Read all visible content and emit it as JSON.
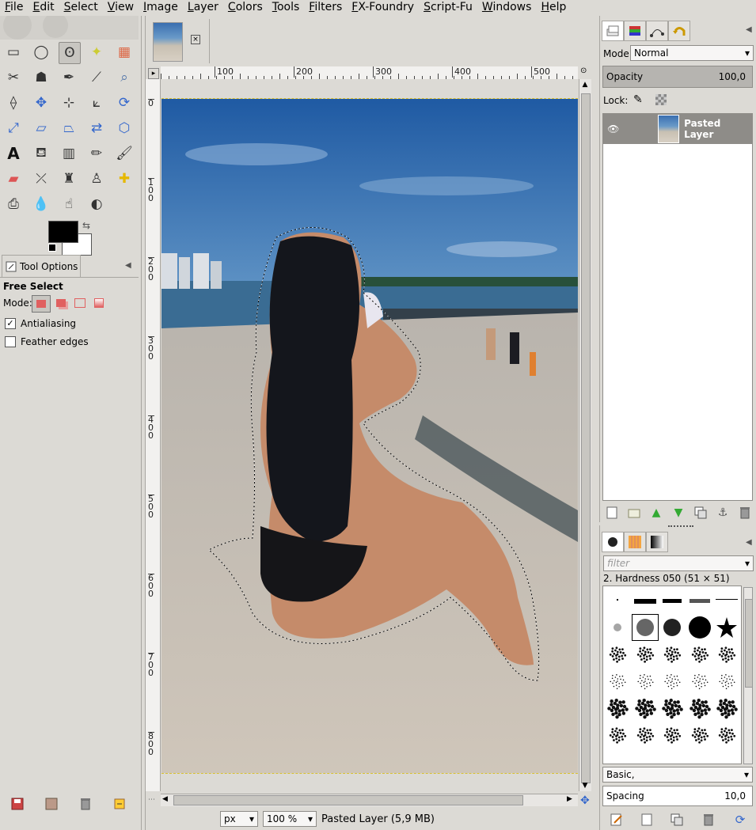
{
  "menubar": {
    "items": [
      "File",
      "Edit",
      "Select",
      "View",
      "Image",
      "Layer",
      "Colors",
      "Tools",
      "Filters",
      "FX-Foundry",
      "Script-Fu",
      "Windows",
      "Help"
    ]
  },
  "toolbox": {
    "tools": [
      "rect-select-icon",
      "ellipse-select-icon",
      "free-select-icon",
      "fuzzy-select-icon",
      "color-select-icon",
      "scissors-icon",
      "foreground-select-icon",
      "paths-icon",
      "color-picker-icon",
      "zoom-icon",
      "measure-icon",
      "move-icon",
      "align-icon",
      "crop-icon",
      "rotate-icon",
      "scale-icon",
      "shear-icon",
      "perspective-icon",
      "flip-icon",
      "cage-icon",
      "text-icon",
      "bucket-fill-icon",
      "blend-icon",
      "pencil-icon",
      "paintbrush-icon",
      "eraser-icon",
      "airbrush-icon",
      "ink-icon",
      "clone-icon",
      "heal-icon",
      "perspective-clone-icon",
      "blur-icon",
      "smudge-icon",
      "dodge-burn-icon",
      ""
    ],
    "active_tool_index": 2,
    "fg_color": "#000000",
    "bg_color": "#ffffff"
  },
  "tool_options": {
    "tab_label": "Tool Options",
    "title": "Free Select",
    "mode_label": "Mode:",
    "antialiasing_label": "Antialiasing",
    "antialiasing_checked": true,
    "feather_label": "Feather edges",
    "feather_checked": false
  },
  "canvas": {
    "ruler_h_labels": [
      "100",
      "200",
      "300",
      "400",
      "500"
    ],
    "ruler_v_labels": [
      "0",
      "100",
      "200",
      "300",
      "400",
      "500",
      "600",
      "700",
      "800"
    ],
    "status": {
      "unit": "px",
      "zoom": "100 %",
      "info": "Pasted Layer (5,9 MB)"
    }
  },
  "layers": {
    "mode_label": "Mode:",
    "mode_value": "Normal",
    "opacity_label": "Opacity",
    "opacity_value": "100,0",
    "lock_label": "Lock:",
    "layer_name": "Pasted Layer"
  },
  "brushes": {
    "filter_placeholder": "filter",
    "selected_brush": "2. Hardness 050 (51 × 51)",
    "preset": "Basic,",
    "spacing_label": "Spacing",
    "spacing_value": "10,0"
  },
  "colors": {
    "sky_top": "#2f66a8",
    "sand": "#c9c1b4",
    "sea": "#3e6f95"
  }
}
